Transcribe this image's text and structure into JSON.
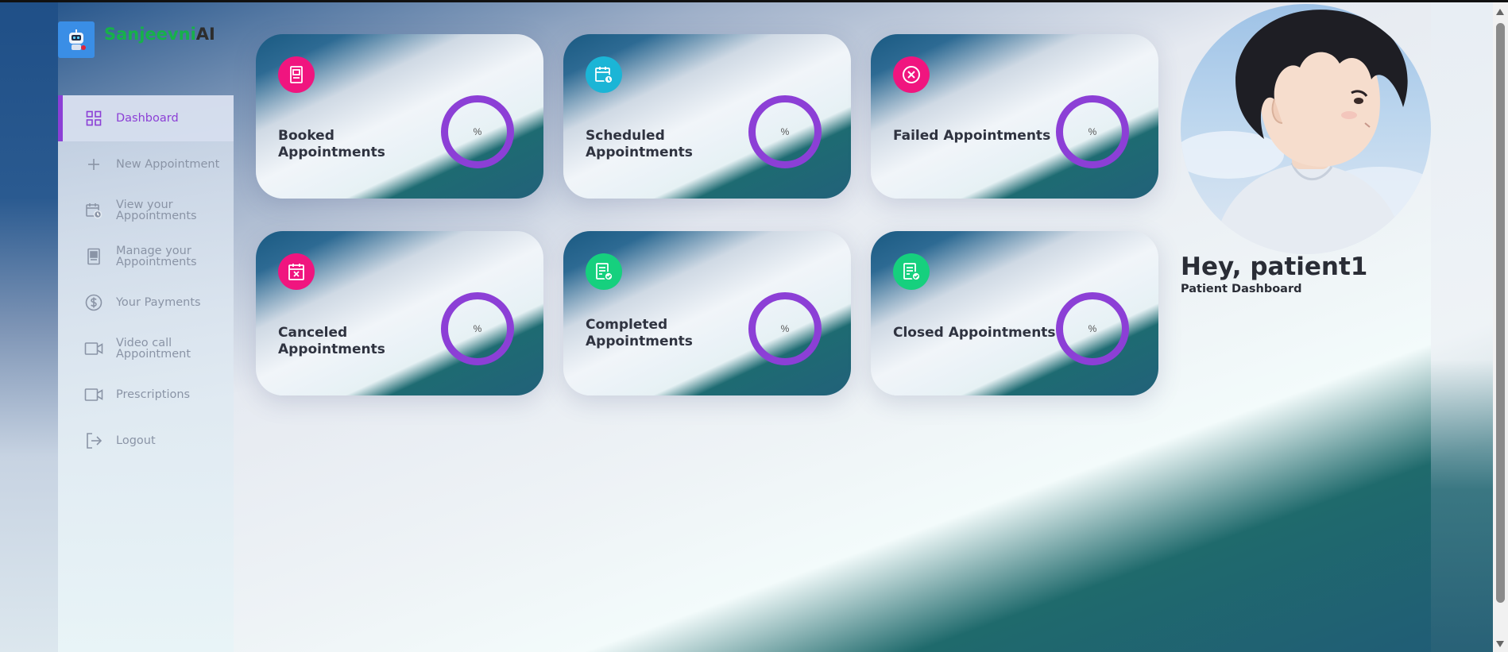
{
  "brand": {
    "name_part1": "Sanjeevni",
    "name_part2": "AI"
  },
  "sidebar": {
    "items": [
      {
        "label": "Dashboard",
        "icon": "grid-icon",
        "active": true
      },
      {
        "label": "New Appointment",
        "icon": "plus-icon"
      },
      {
        "label": "View your Appointments",
        "icon": "calendar-clock-icon"
      },
      {
        "label": "Manage your Appointments",
        "icon": "document-icon"
      },
      {
        "label": "Your Payments",
        "icon": "dollar-icon"
      },
      {
        "label": "Video call Appointment",
        "icon": "video-icon"
      },
      {
        "label": "Prescriptions",
        "icon": "video-icon"
      },
      {
        "label": "Logout",
        "icon": "logout-icon"
      }
    ]
  },
  "cards": [
    {
      "title": "Booked Appointments",
      "value": "%",
      "icon": "document-icon",
      "icon_color": "#f0157f"
    },
    {
      "title": "Scheduled Appointments",
      "value": "%",
      "icon": "calendar-clock-icon",
      "icon_color": "#1bb5d6"
    },
    {
      "title": "Failed Appointments",
      "value": "%",
      "icon": "x-circle-icon",
      "icon_color": "#f0157f"
    },
    {
      "title": "Canceled Appointments",
      "value": "%",
      "icon": "calendar-x-icon",
      "icon_color": "#f0157f"
    },
    {
      "title": "Completed Appointments",
      "value": "%",
      "icon": "checked-document-icon",
      "icon_color": "#16d07e"
    },
    {
      "title": "Closed Appointments",
      "value": "%",
      "icon": "checked-document-icon",
      "icon_color": "#16d07e"
    }
  ],
  "profile": {
    "greeting": "Hey, patient1",
    "subtitle": "Patient Dashboard"
  },
  "colors": {
    "accent": "#8c3fd6",
    "brand_green": "#16b14a"
  }
}
